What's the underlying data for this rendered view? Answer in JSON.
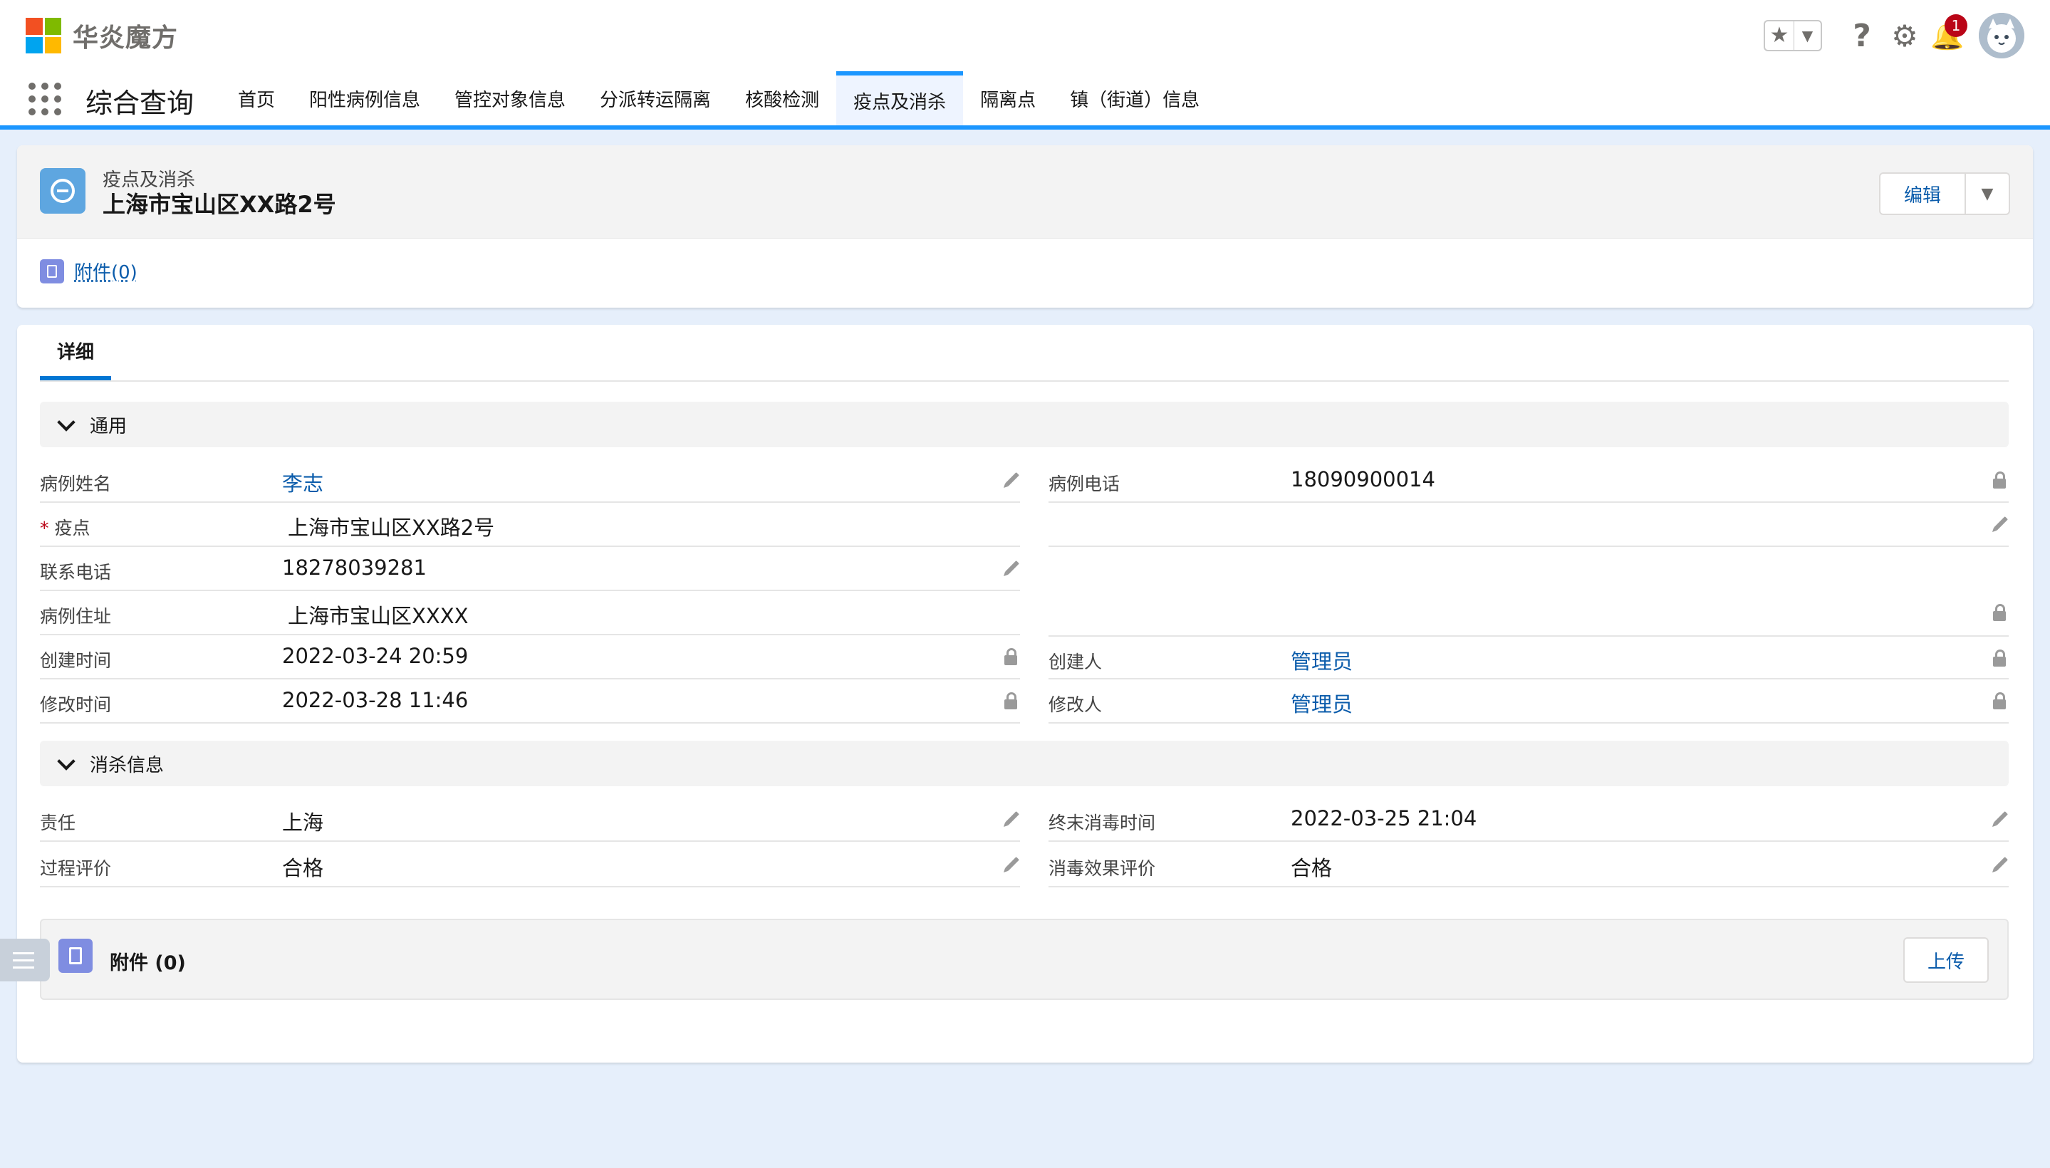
{
  "brand": {
    "name": "华炎魔方",
    "logo_colors": [
      "#f25022",
      "#7fba00",
      "#00a4ef",
      "#ffb900"
    ]
  },
  "header": {
    "notification_count": "1",
    "icons": [
      "star-icon",
      "chevron-down-icon",
      "help-icon",
      "gear-icon",
      "bell-icon",
      "avatar"
    ]
  },
  "app": {
    "name": "综合查询",
    "tabs": [
      {
        "label": "首页"
      },
      {
        "label": "阳性病例信息"
      },
      {
        "label": "管控对象信息"
      },
      {
        "label": "分派转运隔离"
      },
      {
        "label": "核酸检测"
      },
      {
        "label": "疫点及消杀",
        "active": true
      },
      {
        "label": "隔离点"
      },
      {
        "label": "镇（街道）信息"
      }
    ]
  },
  "record": {
    "object_label": "疫点及消杀",
    "title": "上海市宝山区XX路2号",
    "edit_label": "编辑",
    "related_link": "附件(0)"
  },
  "detail": {
    "tab_label": "详细",
    "section_general": {
      "title": "通用",
      "fields": {
        "case_name": {
          "label": "病例姓名",
          "value": "李志"
        },
        "case_phone": {
          "label": "病例电话",
          "value": "18090900014"
        },
        "spot": {
          "required_mark": "*",
          "label": "疫点",
          "value": "上海市宝山区XX路2号"
        },
        "contact_phone": {
          "label": "联系电话",
          "value": "18278039281"
        },
        "case_address": {
          "label": "病例住址",
          "value": "上海市宝山区XXXX"
        },
        "created_time": {
          "label": "创建时间",
          "value": "2022-03-24 20:59"
        },
        "created_by": {
          "label": "创建人",
          "value": "管理员"
        },
        "modified_time": {
          "label": "修改时间",
          "value": "2022-03-28 11:46"
        },
        "modified_by": {
          "label": "修改人",
          "value": "管理员"
        }
      }
    },
    "section_disinfection": {
      "title": "消杀信息",
      "fields": {
        "responsibility": {
          "label": "责任",
          "value": "上海"
        },
        "final_disinfect_time": {
          "label": "终末消毒时间",
          "value": "2022-03-25 21:04"
        },
        "process_eval": {
          "label": "过程评价",
          "value": "合格"
        },
        "effect_eval": {
          "label": "消毒效果评价",
          "value": "合格"
        }
      }
    }
  },
  "attachments": {
    "title": "附件 (0)",
    "upload_label": "上传"
  },
  "colors": {
    "accent": "#1b96ff",
    "link": "#0b5cab",
    "page_bg": "#e6effb",
    "record_icon": "#5ea6e0",
    "file_icon": "#7f8de1",
    "badge": "#ba0517",
    "required": "#ba0517"
  }
}
